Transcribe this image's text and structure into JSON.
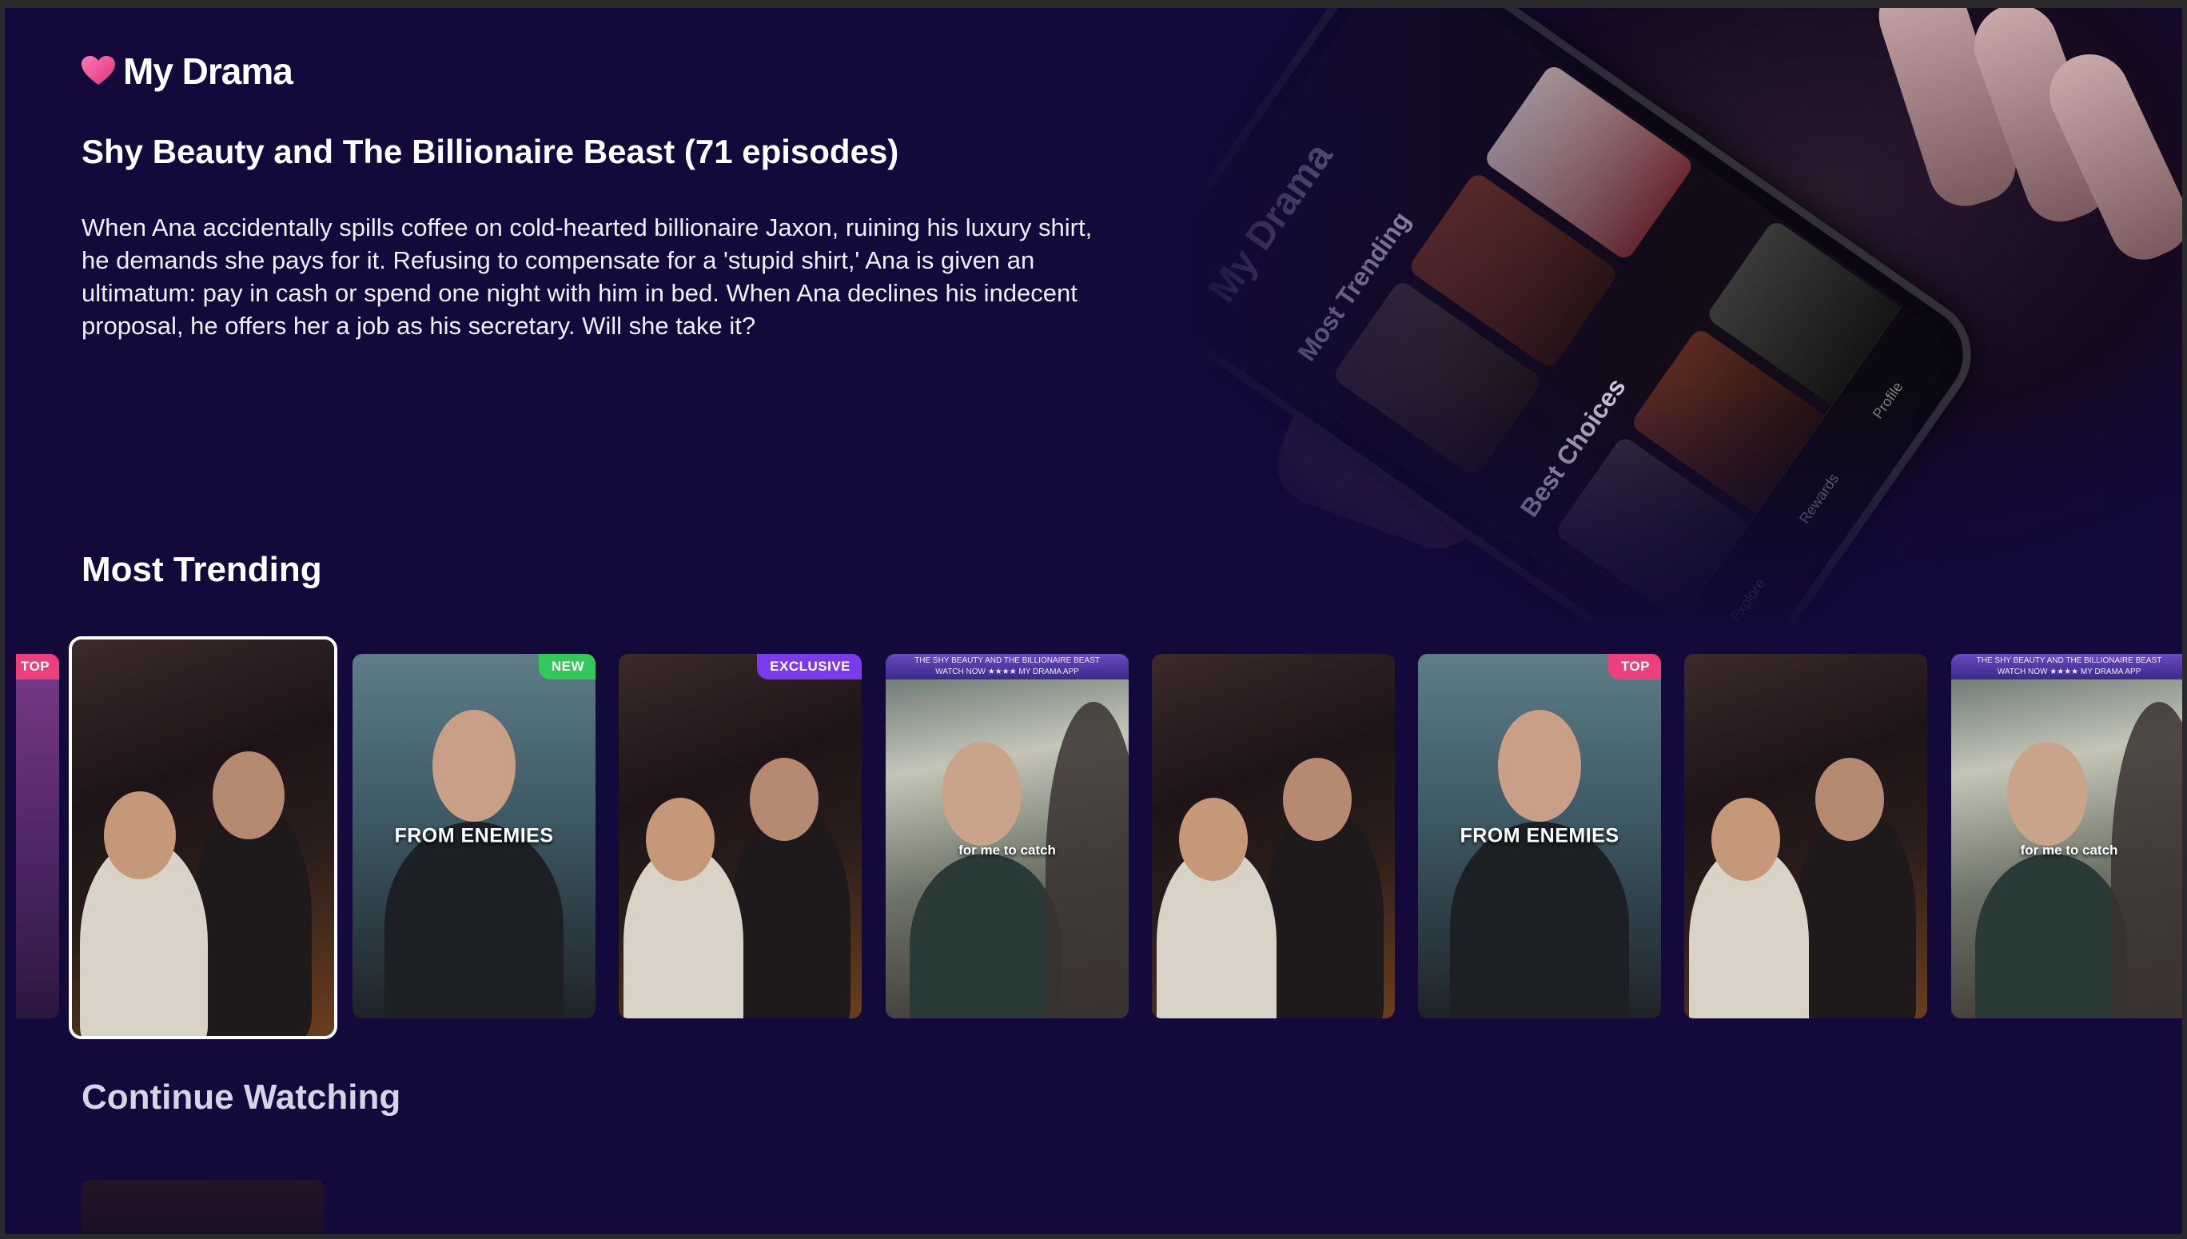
{
  "app": {
    "name": "My Drama",
    "logo_icon": "heart-icon",
    "accent": "#ec4899"
  },
  "hero": {
    "title": "Shy Beauty and The Billionaire Beast (71 episodes)",
    "description": "When Ana accidentally spills coffee on cold-hearted billionaire Jaxon, ruining his luxury shirt, he demands she pays for it. Refusing to compensate for a 'stupid shirt,' Ana is given an ultimatum: pay in cash or spend one night with him in bed. When Ana declines his indecent proposal, he offers her a job as his secretary. Will she take it?",
    "phone_mock": {
      "app_title": "My Drama",
      "section_1": "Most Trending",
      "section_2": "Best Choices",
      "tabs": [
        "Explore",
        "Rewards",
        "Profile"
      ]
    }
  },
  "sections": {
    "trending": "Most Trending",
    "continue": "Continue Watching"
  },
  "cards": [
    {
      "badge": "TOP",
      "badge_color": "#ec407a"
    },
    {
      "badge": "",
      "caption": ""
    },
    {
      "badge": "NEW",
      "badge_color": "#34c759",
      "caption": "FROM ENEMIES"
    },
    {
      "badge": "EXCLUSIVE",
      "badge_color": "#7c3aed",
      "caption": ""
    },
    {
      "badge": "",
      "caption": "for me to catch",
      "banner_1": "THE SHY BEAUTY AND THE BILLIONAIRE BEAST",
      "banner_2": "WATCH NOW ★★★★ MY DRAMA APP"
    },
    {
      "badge": "",
      "caption": ""
    },
    {
      "badge": "TOP",
      "badge_color": "#ec407a",
      "caption": "FROM ENEMIES"
    },
    {
      "badge": "",
      "caption": ""
    },
    {
      "badge": "",
      "caption": "for me to catch",
      "banner_1": "THE SHY BEAUTY AND THE BILLIONAIRE BEAST",
      "banner_2": "WATCH NOW ★★★★ MY DRAMA APP"
    }
  ]
}
